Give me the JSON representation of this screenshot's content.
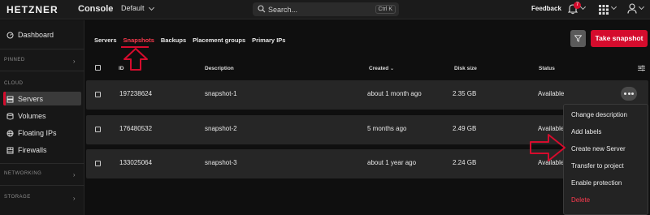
{
  "topbar": {
    "logo": "HETZNER",
    "console": "Console",
    "project": "Default",
    "search_placeholder": "Search...",
    "search_shortcut": "Ctrl K",
    "feedback": "Feedback",
    "notifications_count": "7"
  },
  "sidebar": {
    "dashboard": "Dashboard",
    "pinned": "PINNED",
    "cloud": "CLOUD",
    "servers": "Servers",
    "volumes": "Volumes",
    "floating_ips": "Floating IPs",
    "firewalls": "Firewalls",
    "networking": "NETWORKING",
    "storage": "STORAGE"
  },
  "tabs": [
    "Servers",
    "Snapshots",
    "Backups",
    "Placement groups",
    "Primary IPs"
  ],
  "active_tab": "Snapshots",
  "actions": {
    "take_snapshot": "Take snapshot"
  },
  "table": {
    "headers": {
      "id": "ID",
      "description": "Description",
      "created": "Created",
      "disk_size": "Disk size",
      "status": "Status"
    },
    "rows": [
      {
        "id": "197238624",
        "description": "snapshot-1",
        "created": "about 1 month ago",
        "disk_size": "2.35 GB",
        "status": "Available"
      },
      {
        "id": "176480532",
        "description": "snapshot-2",
        "created": "5 months ago",
        "disk_size": "2.49 GB",
        "status": "Available"
      },
      {
        "id": "133025064",
        "description": "snapshot-3",
        "created": "about 1 year ago",
        "disk_size": "2.24 GB",
        "status": "Available"
      }
    ]
  },
  "context_menu": {
    "items": [
      "Change description",
      "Add labels",
      "Create new Server",
      "Transfer to project",
      "Enable protection",
      "Delete"
    ]
  },
  "colors": {
    "accent": "#d50c2d",
    "background": "#0f0f0f",
    "row": "#262626"
  }
}
